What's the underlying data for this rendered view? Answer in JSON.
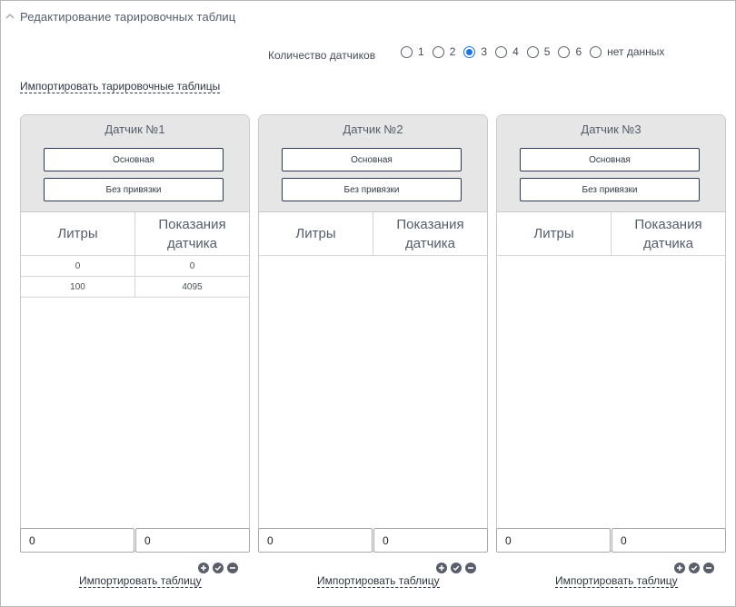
{
  "section": {
    "title": "Редактирование тарировочных таблиц",
    "icon": "chevron-up-icon"
  },
  "sensor_count": {
    "label": "Количество датчиков",
    "options": [
      "1",
      "2",
      "3",
      "4",
      "5",
      "6",
      "нет данных"
    ],
    "selected": "3"
  },
  "import_all_label": "Импортировать тарировочные таблицы",
  "panels": [
    {
      "title": "Датчик №1",
      "main_button": "Основная",
      "unbound_button": "Без привязки",
      "col_liters": "Литры",
      "col_reading": "Показания датчика",
      "rows": [
        {
          "liters": "0",
          "reading": "0"
        },
        {
          "liters": "100",
          "reading": "4095"
        }
      ],
      "input_liters": "0",
      "input_reading": "0",
      "import_label": "Импортировать таблицу"
    },
    {
      "title": "Датчик №2",
      "main_button": "Основная",
      "unbound_button": "Без привязки",
      "col_liters": "Литры",
      "col_reading": "Показания датчика",
      "rows": [],
      "input_liters": "0",
      "input_reading": "0",
      "import_label": "Импортировать таблицу"
    },
    {
      "title": "Датчик №3",
      "main_button": "Основная",
      "unbound_button": "Без привязки",
      "col_liters": "Литры",
      "col_reading": "Показания датчика",
      "rows": [],
      "input_liters": "0",
      "input_reading": "0",
      "import_label": "Импортировать таблицу"
    }
  ],
  "row_actions": [
    "add-icon",
    "confirm-icon",
    "remove-icon"
  ]
}
